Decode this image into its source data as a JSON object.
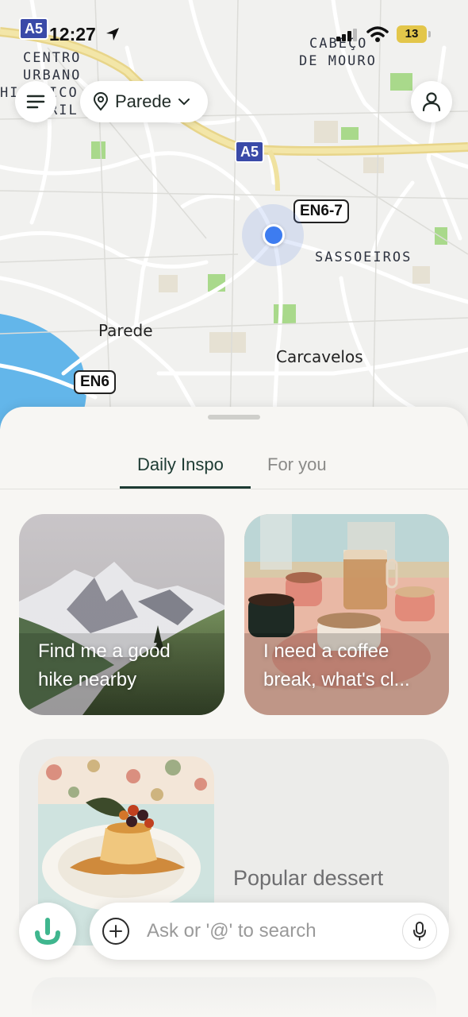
{
  "status_bar": {
    "time": "12:27",
    "battery": "13",
    "icons": [
      "location-arrow-icon",
      "cellular-signal-icon",
      "wifi-icon",
      "battery-icon"
    ]
  },
  "map": {
    "area_labels": [
      "CENTRO",
      "URBANO",
      "HIS",
      "ICO",
      "RIL",
      "CABEÇO",
      "DE MOURO",
      "SASSOEIROS"
    ],
    "places": [
      "Parede",
      "Carcavelos"
    ],
    "road_shields": [
      "A5",
      "A5",
      "EN6-7",
      "EN6"
    ],
    "water_color": "#63b6ea",
    "location_dot_color": "#3d7cf0"
  },
  "top_controls": {
    "location_name": "Parede",
    "icons": [
      "menu-icon",
      "location-pin-icon",
      "chevron-down-icon",
      "user-icon"
    ]
  },
  "sheet": {
    "tabs": [
      {
        "label": "Daily Inspo",
        "active": true
      },
      {
        "label": "For you",
        "active": false
      }
    ],
    "cards": [
      {
        "title": "Find me a good hike nearby",
        "line1": "Find me a good",
        "line2": "hike nearby"
      },
      {
        "title": "I need a coffee break, what's cl...",
        "line1": "I need a coffee",
        "line2": "break, what's cl..."
      }
    ],
    "featured": {
      "title": "Popular dessert"
    }
  },
  "bottom_bar": {
    "search_placeholder": "Ask or '@' to search",
    "icons": [
      "assistant-logo-icon",
      "plus-icon",
      "microphone-icon"
    ]
  },
  "colors": {
    "accent": "#1d3b33",
    "brand": "#3fb68e"
  }
}
